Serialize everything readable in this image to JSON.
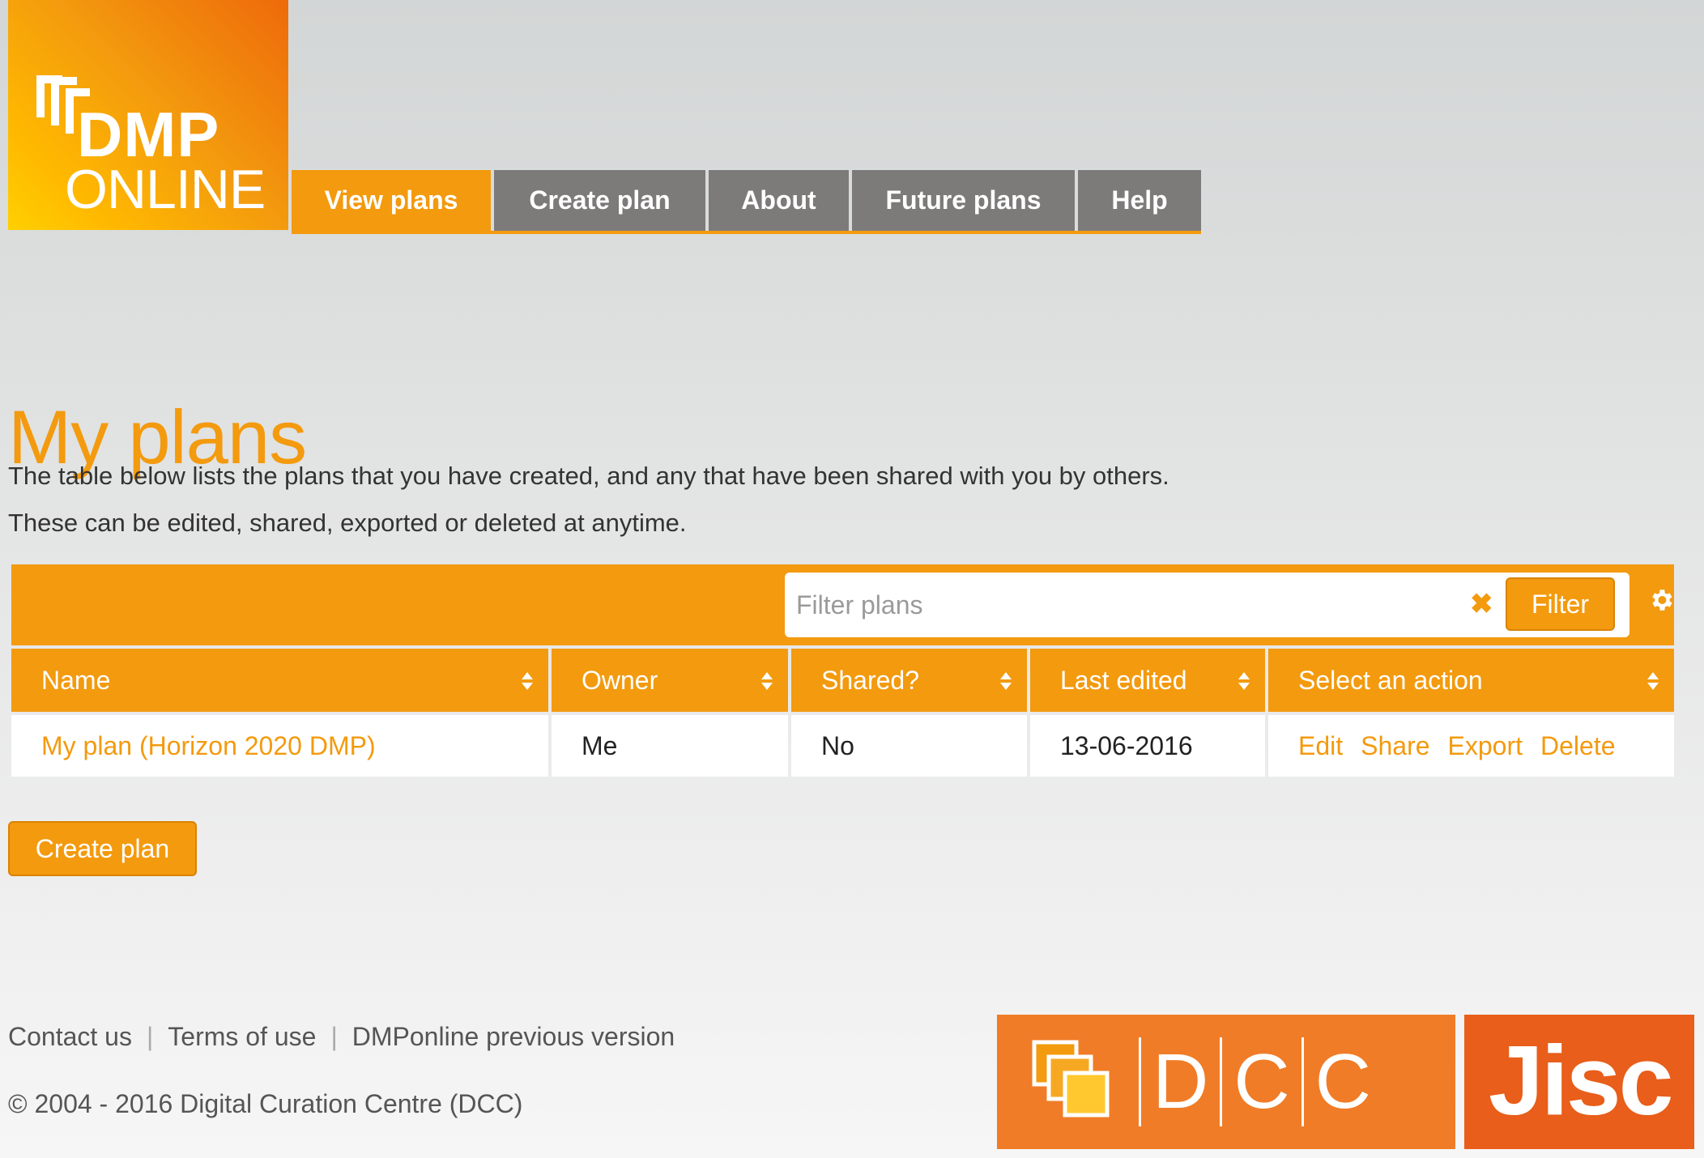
{
  "brand": {
    "logo_line1": "DMP",
    "logo_line2": "ONLINE"
  },
  "nav": {
    "items": [
      {
        "label": "View plans",
        "active": true
      },
      {
        "label": "Create plan",
        "active": false
      },
      {
        "label": "About",
        "active": false
      },
      {
        "label": "Future plans",
        "active": false
      },
      {
        "label": "Help",
        "active": false
      }
    ]
  },
  "page": {
    "title": "My plans",
    "intro_line1": "The table below lists the plans that you have created, and any that have been shared with you by others.",
    "intro_line2": "These can be edited, shared, exported or deleted at anytime."
  },
  "filter": {
    "placeholder": "Filter plans",
    "value": "",
    "clear_icon": "close-icon",
    "button_label": "Filter",
    "settings_icon": "gear-icon"
  },
  "table": {
    "columns": [
      "Name",
      "Owner",
      "Shared?",
      "Last edited",
      "Select an action"
    ],
    "rows": [
      {
        "name": "My plan (Horizon 2020 DMP)",
        "owner": "Me",
        "shared": "No",
        "last_edited": "13-06-2016",
        "actions": [
          "Edit",
          "Share",
          "Export",
          "Delete"
        ]
      }
    ]
  },
  "create_button": "Create plan",
  "footer": {
    "links": [
      "Contact us",
      "Terms of use",
      "DMPonline previous version"
    ],
    "copyright": "© 2004 - 2016 Digital Curation Centre (DCC)",
    "dcc_letters": [
      "D",
      "C",
      "C"
    ],
    "jisc_label": "Jisc"
  },
  "colors": {
    "accent": "#f39a0e",
    "nav_inactive": "#7d7a7a",
    "dcc_orange": "#f07c27",
    "jisc_orange": "#e85e1a"
  }
}
